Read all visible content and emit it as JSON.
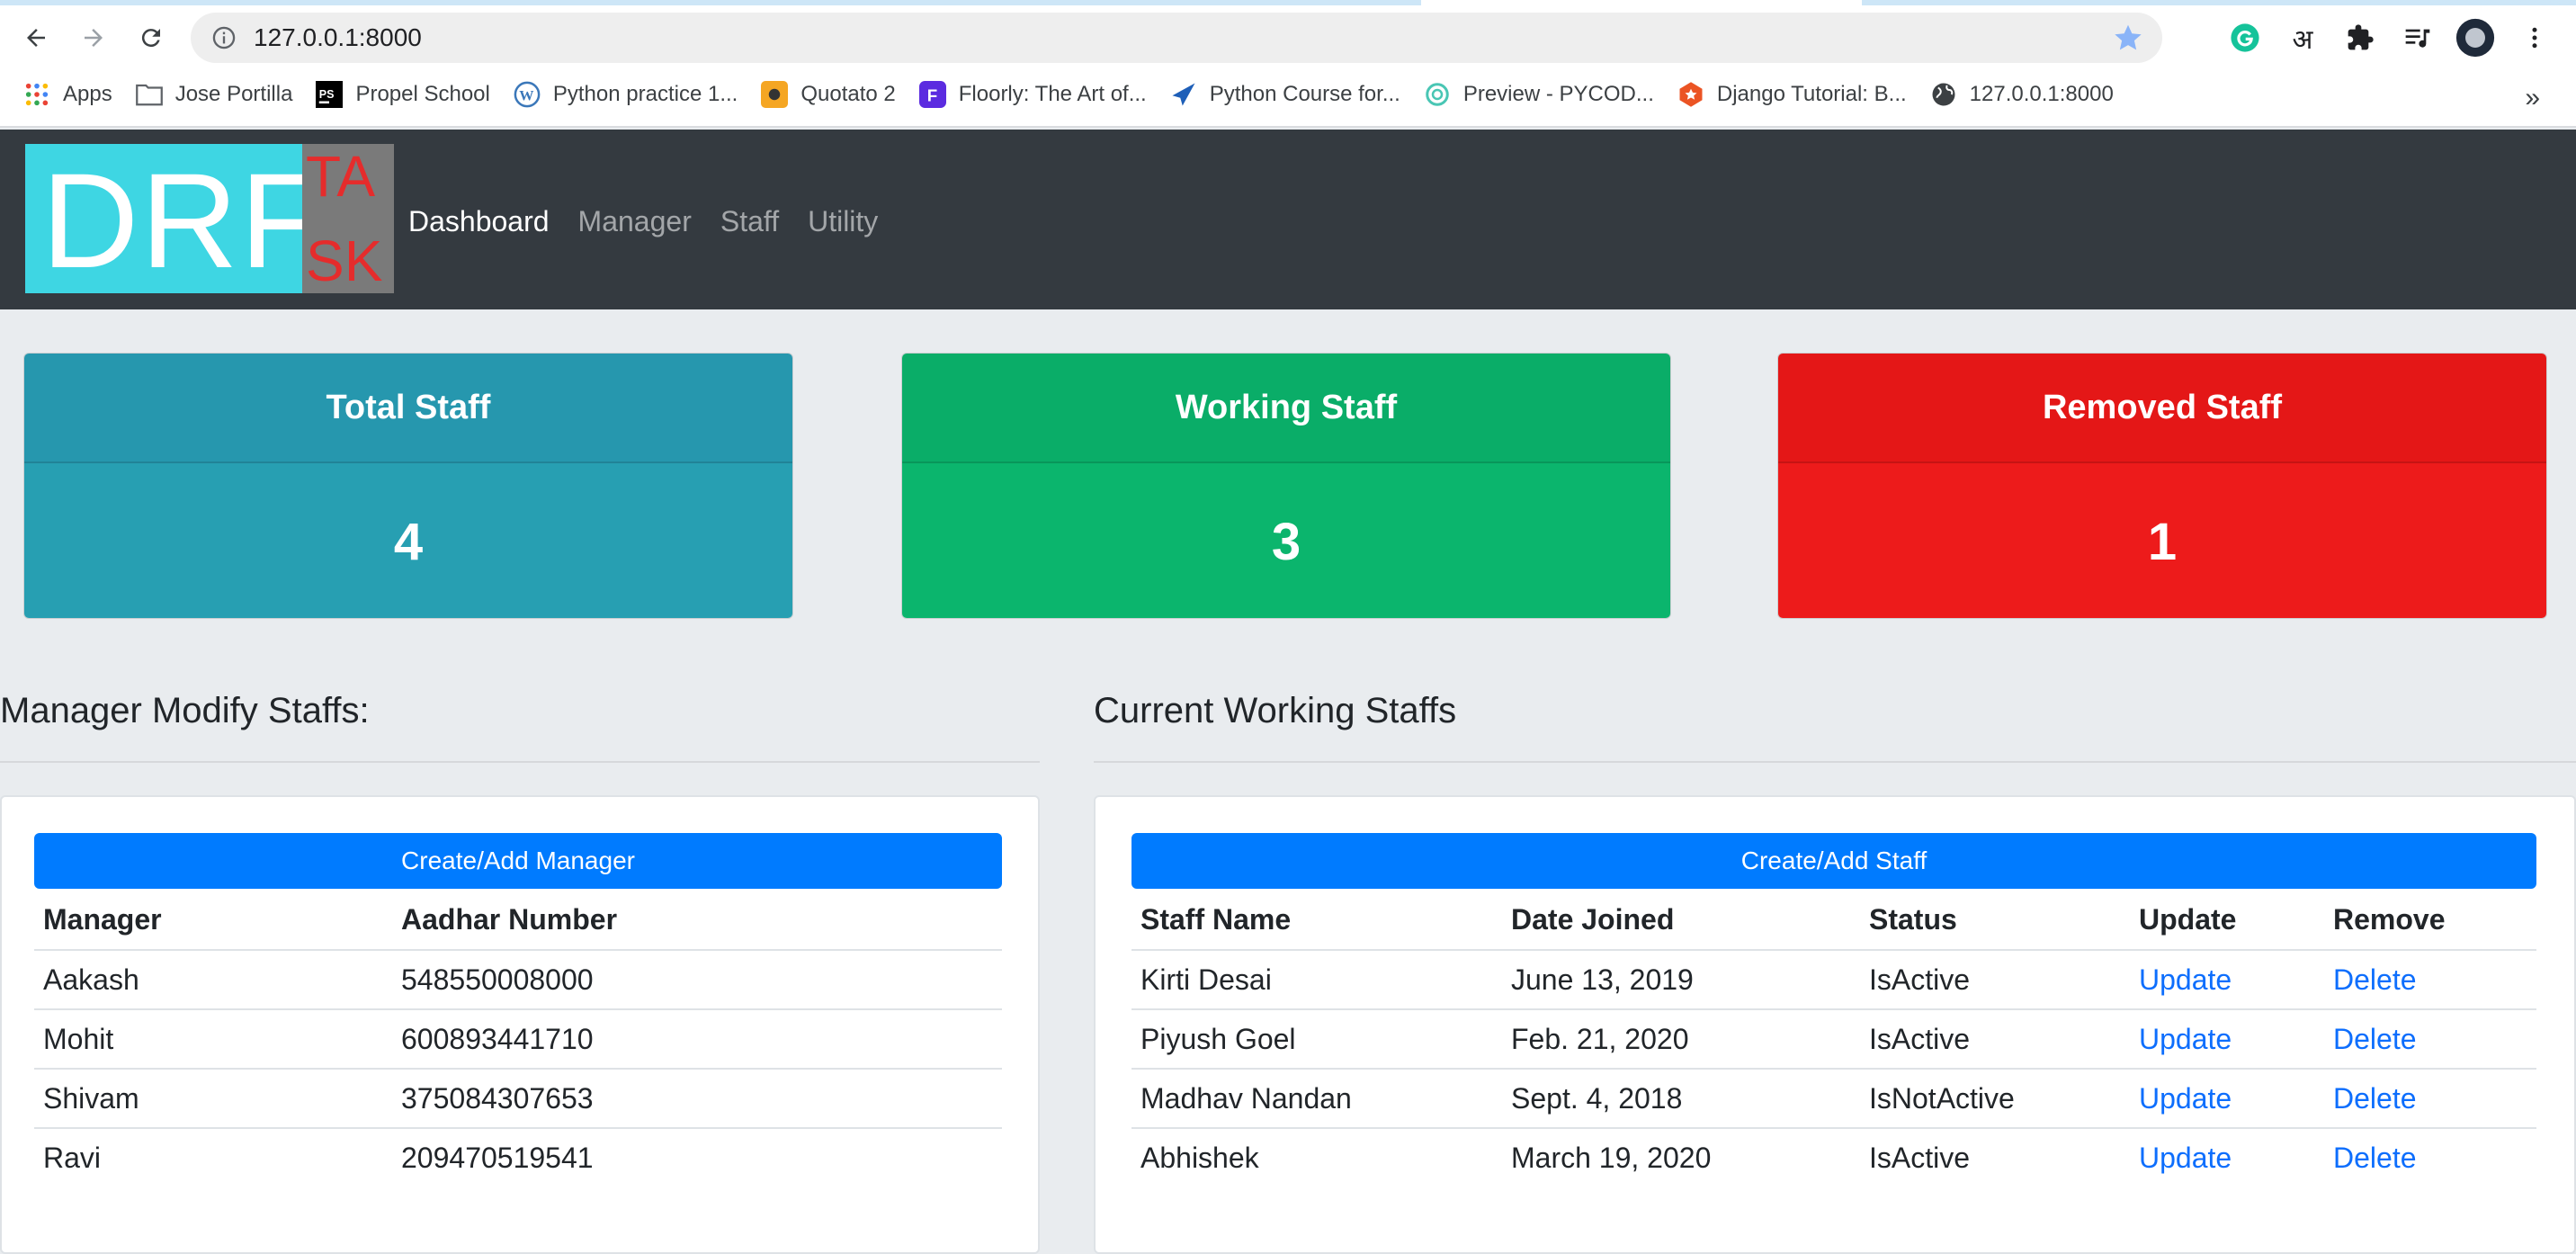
{
  "browser": {
    "url": "127.0.0.1:8000",
    "bookmarks": [
      {
        "label": "Apps",
        "icon": "apps-grid-icon"
      },
      {
        "label": "Jose Portilla",
        "icon": "folder-icon"
      },
      {
        "label": "Propel School",
        "icon": "pycharm-icon"
      },
      {
        "label": "Python practice 1...",
        "icon": "wordpress-icon"
      },
      {
        "label": "Quotato 2",
        "icon": "quotato-icon"
      },
      {
        "label": "Floorly: The Art of...",
        "icon": "floorly-icon"
      },
      {
        "label": "Python Course for...",
        "icon": "plane-icon"
      },
      {
        "label": "Preview - PYCOD...",
        "icon": "swirl-icon"
      },
      {
        "label": "Django Tutorial: B...",
        "icon": "badge-icon"
      },
      {
        "label": "127.0.0.1:8000",
        "icon": "globe-icon"
      }
    ],
    "more": "»",
    "ext_hindi": "अ"
  },
  "logo": {
    "main": "DRF",
    "side_top": "TA",
    "side_bottom": "SK"
  },
  "nav": {
    "dashboard": "Dashboard",
    "manager": "Manager",
    "staff": "Staff",
    "utility": "Utility"
  },
  "stats": {
    "total": {
      "title": "Total Staff",
      "value": "4"
    },
    "working": {
      "title": "Working Staff",
      "value": "3"
    },
    "removed": {
      "title": "Removed Staff",
      "value": "1"
    }
  },
  "managers": {
    "title": "Manager Modify Staffs:",
    "button": "Create/Add Manager",
    "headers": [
      "Manager",
      "Aadhar Number"
    ],
    "rows": [
      [
        "Aakash",
        "548550008000"
      ],
      [
        "Mohit",
        "600893441710"
      ],
      [
        "Shivam",
        "375084307653"
      ],
      [
        "Ravi",
        "209470519541"
      ]
    ]
  },
  "staffs": {
    "title": "Current Working Staffs",
    "button": "Create/Add Staff",
    "headers": [
      "Staff Name",
      "Date Joined",
      "Status",
      "Update",
      "Remove"
    ],
    "rows": [
      [
        "Kirti Desai",
        "June 13, 2019",
        "IsActive",
        "Update",
        "Delete"
      ],
      [
        "Piyush Goel",
        "Feb. 21, 2020",
        "IsActive",
        "Update",
        "Delete"
      ],
      [
        "Madhav Nandan",
        "Sept. 4, 2018",
        "IsNotActive",
        "Update",
        "Delete"
      ],
      [
        "Abhishek",
        "March 19, 2020",
        "IsActive",
        "Update",
        "Delete"
      ]
    ]
  }
}
